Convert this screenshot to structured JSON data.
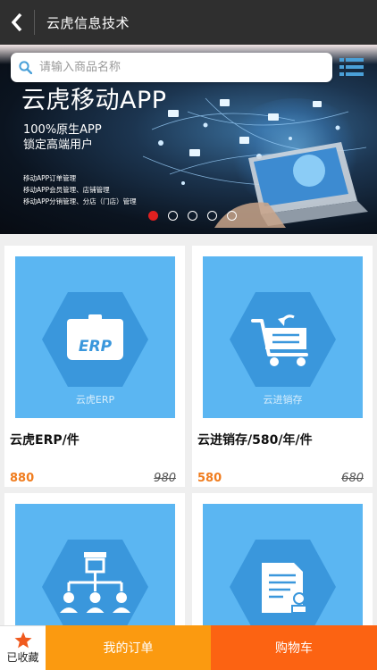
{
  "header": {
    "title": "云虎信息技术"
  },
  "search": {
    "placeholder": "请输入商品名称"
  },
  "banner": {
    "title": "云虎移动APP",
    "line1": "100%原生APP",
    "line2": "锁定高端用户",
    "small1": "移动APP订单管理",
    "small2": "移动APP会员管理、店铺管理",
    "small3": "移动APP分销管理、分店（门店）管理",
    "slide_count": 5,
    "active_slide": 1
  },
  "products": [
    {
      "image_caption": "云虎ERP",
      "name": "云虎ERP/件",
      "price": "880",
      "original_price": "980",
      "icon": "erp-box-icon"
    },
    {
      "image_caption": "云进销存",
      "name": "云进销存/580/年/件",
      "price": "580",
      "original_price": "680",
      "icon": "shopping-cart-icon"
    },
    {
      "image_caption": "",
      "name": "",
      "price": "",
      "original_price": "",
      "icon": "store-distribution-icon"
    },
    {
      "image_caption": "",
      "name": "",
      "price": "",
      "original_price": "",
      "icon": "document-stamp-icon"
    }
  ],
  "bottom_bar": {
    "favorite_label": "已收藏",
    "orders_label": "我的订单",
    "cart_label": "购物车"
  },
  "colors": {
    "header_bg": "#2f2f2f",
    "product_tile": "#5bb6f2",
    "price": "#f07c1e",
    "orders_btn": "#fb9a10",
    "cart_btn": "#fc6312",
    "active_dot": "#e02020"
  }
}
